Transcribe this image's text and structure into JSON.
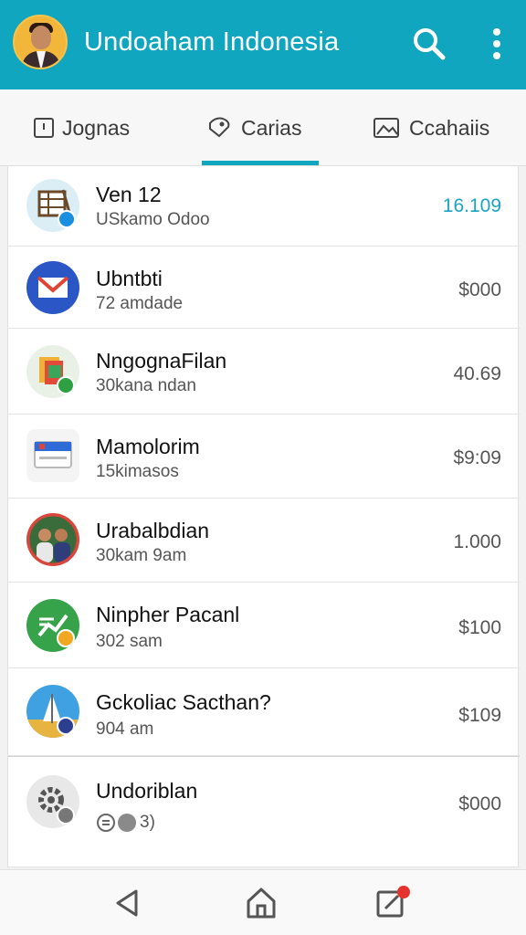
{
  "app": {
    "title": "Undoaham Indonesia",
    "accent": "#10a6bf"
  },
  "tabs": [
    {
      "label": "Jognas",
      "icon": "square-icon"
    },
    {
      "label": "Carias",
      "icon": "tag-icon",
      "active": true
    },
    {
      "label": "Ccahaiis",
      "icon": "image-icon"
    }
  ],
  "list": [
    {
      "title": "Ven 12",
      "subtitle": "USkamo Odoo",
      "amount": "16.109",
      "amount_color": "#1aa3c6",
      "icon": "spreadsheet-icon"
    },
    {
      "title": "Ubntbti",
      "subtitle": "72 amdade",
      "amount": "$000",
      "amount_color": "#555555",
      "icon": "mail-icon"
    },
    {
      "title": "NngognaFilan",
      "subtitle": "30kana ndan",
      "amount": "40.69",
      "amount_color": "#555555",
      "icon": "files-icon"
    },
    {
      "title": "Mamolorim",
      "subtitle": "15kimasos",
      "amount": "$9:09",
      "amount_color": "#555555",
      "icon": "card-icon"
    },
    {
      "title": "Urabalbdian",
      "subtitle": "30kam 9am",
      "amount": "1.000",
      "amount_color": "#555555",
      "icon": "people-photo-icon"
    },
    {
      "title": "Ninpher Pacanl",
      "subtitle": "302 sam",
      "amount": "$100",
      "amount_color": "#555555",
      "icon": "chart-icon"
    },
    {
      "title": "Gckoliac Sacthan?",
      "subtitle": "904 am",
      "amount": "$109",
      "amount_color": "#555555",
      "icon": "boat-icon"
    },
    {
      "title": "Undoriblan",
      "subtitle": "3)",
      "amount": "$000",
      "amount_color": "#555555",
      "icon": "gear-icon"
    }
  ]
}
